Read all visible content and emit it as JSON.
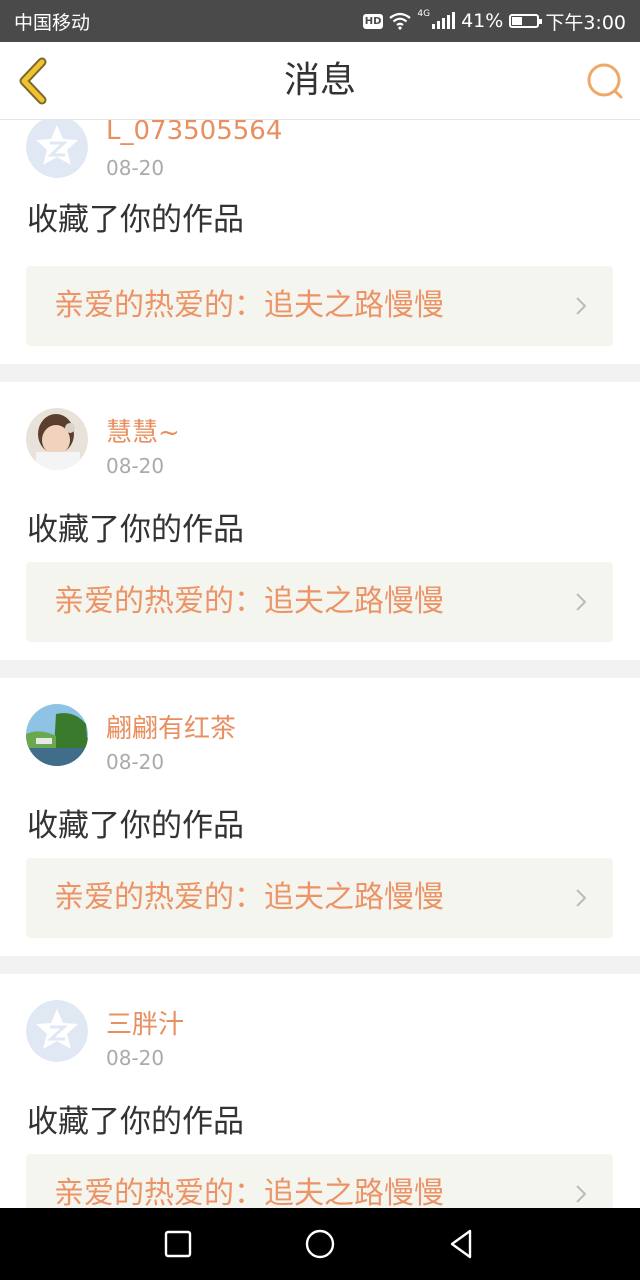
{
  "status_bar": {
    "carrier": "中国移动",
    "hd": "HD",
    "network": "4G",
    "battery_percent": "41%",
    "battery_level": 0.41,
    "time": "下午3:00"
  },
  "header": {
    "title": "消息",
    "back_icon": "chevron-left-icon",
    "search_icon": "search-icon",
    "accent_color": "#f0a868"
  },
  "messages": [
    {
      "username": "L_073505564",
      "date": "08-20",
      "action": "收藏了你的作品",
      "work_title": "亲爱的热爱的：追夫之路慢慢",
      "avatar": "default-avatar"
    },
    {
      "username": "慧慧~",
      "date": "08-20",
      "action": "收藏了你的作品",
      "work_title": "亲爱的热爱的：追夫之路慢慢",
      "avatar": "photo-avatar-girl"
    },
    {
      "username": "翩翩有红茶",
      "date": "08-20",
      "action": "收藏了你的作品",
      "work_title": "亲爱的热爱的：追夫之路慢慢",
      "avatar": "photo-avatar-landscape"
    },
    {
      "username": "三胖汁",
      "date": "08-20",
      "action": "收藏了你的作品",
      "work_title": "亲爱的热爱的：追夫之路慢慢",
      "avatar": "default-avatar"
    }
  ],
  "colors": {
    "username": "#e88f5f",
    "work_title": "#ec9466",
    "link_bg": "#f5f5f0"
  },
  "nav_bar": {
    "buttons": [
      "recents-icon",
      "home-icon",
      "back-icon"
    ]
  }
}
